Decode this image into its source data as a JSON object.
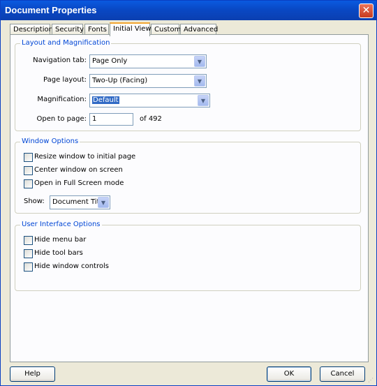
{
  "window": {
    "title": "Document Properties",
    "close_icon": "close-icon"
  },
  "tabs": [
    {
      "label": "Description"
    },
    {
      "label": "Security"
    },
    {
      "label": "Fonts"
    },
    {
      "label": "Initial View",
      "active": true
    },
    {
      "label": "Custom"
    },
    {
      "label": "Advanced"
    }
  ],
  "layout_group": {
    "title": "Layout and Magnification",
    "navigation_label": "Navigation tab:",
    "navigation_value": "Page Only",
    "page_layout_label": "Page layout:",
    "page_layout_value": "Two-Up (Facing)",
    "magnification_label": "Magnification:",
    "magnification_value": "Default",
    "open_to_page_label": "Open to page:",
    "open_to_page_value": "1",
    "of_pages": "of 492"
  },
  "window_group": {
    "title": "Window Options",
    "resize_label": "Resize window to initial page",
    "center_label": "Center window on screen",
    "fullscreen_label": "Open in Full Screen mode",
    "show_label": "Show:",
    "show_value": "Document Title"
  },
  "ui_group": {
    "title": "User Interface Options",
    "hide_menu_label": "Hide menu bar",
    "hide_tool_label": "Hide tool bars",
    "hide_window_label": "Hide window controls"
  },
  "buttons": {
    "help": "Help",
    "ok": "OK",
    "cancel": "Cancel"
  },
  "colors": {
    "titlebar": "#0948c4",
    "group_title": "#0046d5",
    "selection": "#316ac5"
  }
}
